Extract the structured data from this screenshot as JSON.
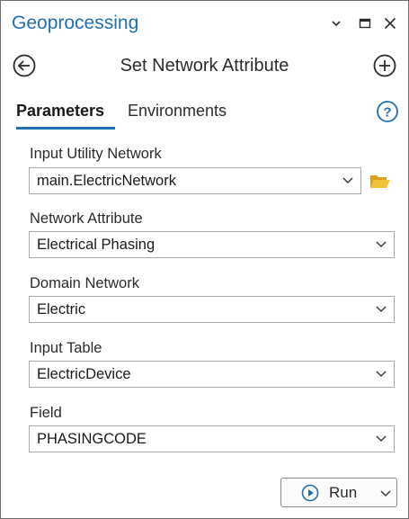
{
  "titlebar": {
    "title": "Geoprocessing",
    "options_icon": "chevron-down-icon",
    "maximize_icon": "maximize-icon",
    "close_icon": "close-icon"
  },
  "tool": {
    "title": "Set Network Attribute",
    "back_icon": "back-arrow-icon",
    "add_icon": "add-icon"
  },
  "tabs": [
    {
      "label": "Parameters",
      "active": true
    },
    {
      "label": "Environments",
      "active": false
    }
  ],
  "help_icon": "help-icon",
  "parameters": [
    {
      "label": "Input Utility Network",
      "value": "main.ElectricNetwork",
      "has_browse": true
    },
    {
      "label": "Network Attribute",
      "value": "Electrical Phasing"
    },
    {
      "label": "Domain Network",
      "value": "Electric"
    },
    {
      "label": "Input Table",
      "value": "ElectricDevice"
    },
    {
      "label": "Field",
      "value": "PHASINGCODE"
    }
  ],
  "run": {
    "label": "Run",
    "icon": "play-icon"
  },
  "colors": {
    "accent": "#1f6fb5",
    "folder": "#e8b32a"
  }
}
